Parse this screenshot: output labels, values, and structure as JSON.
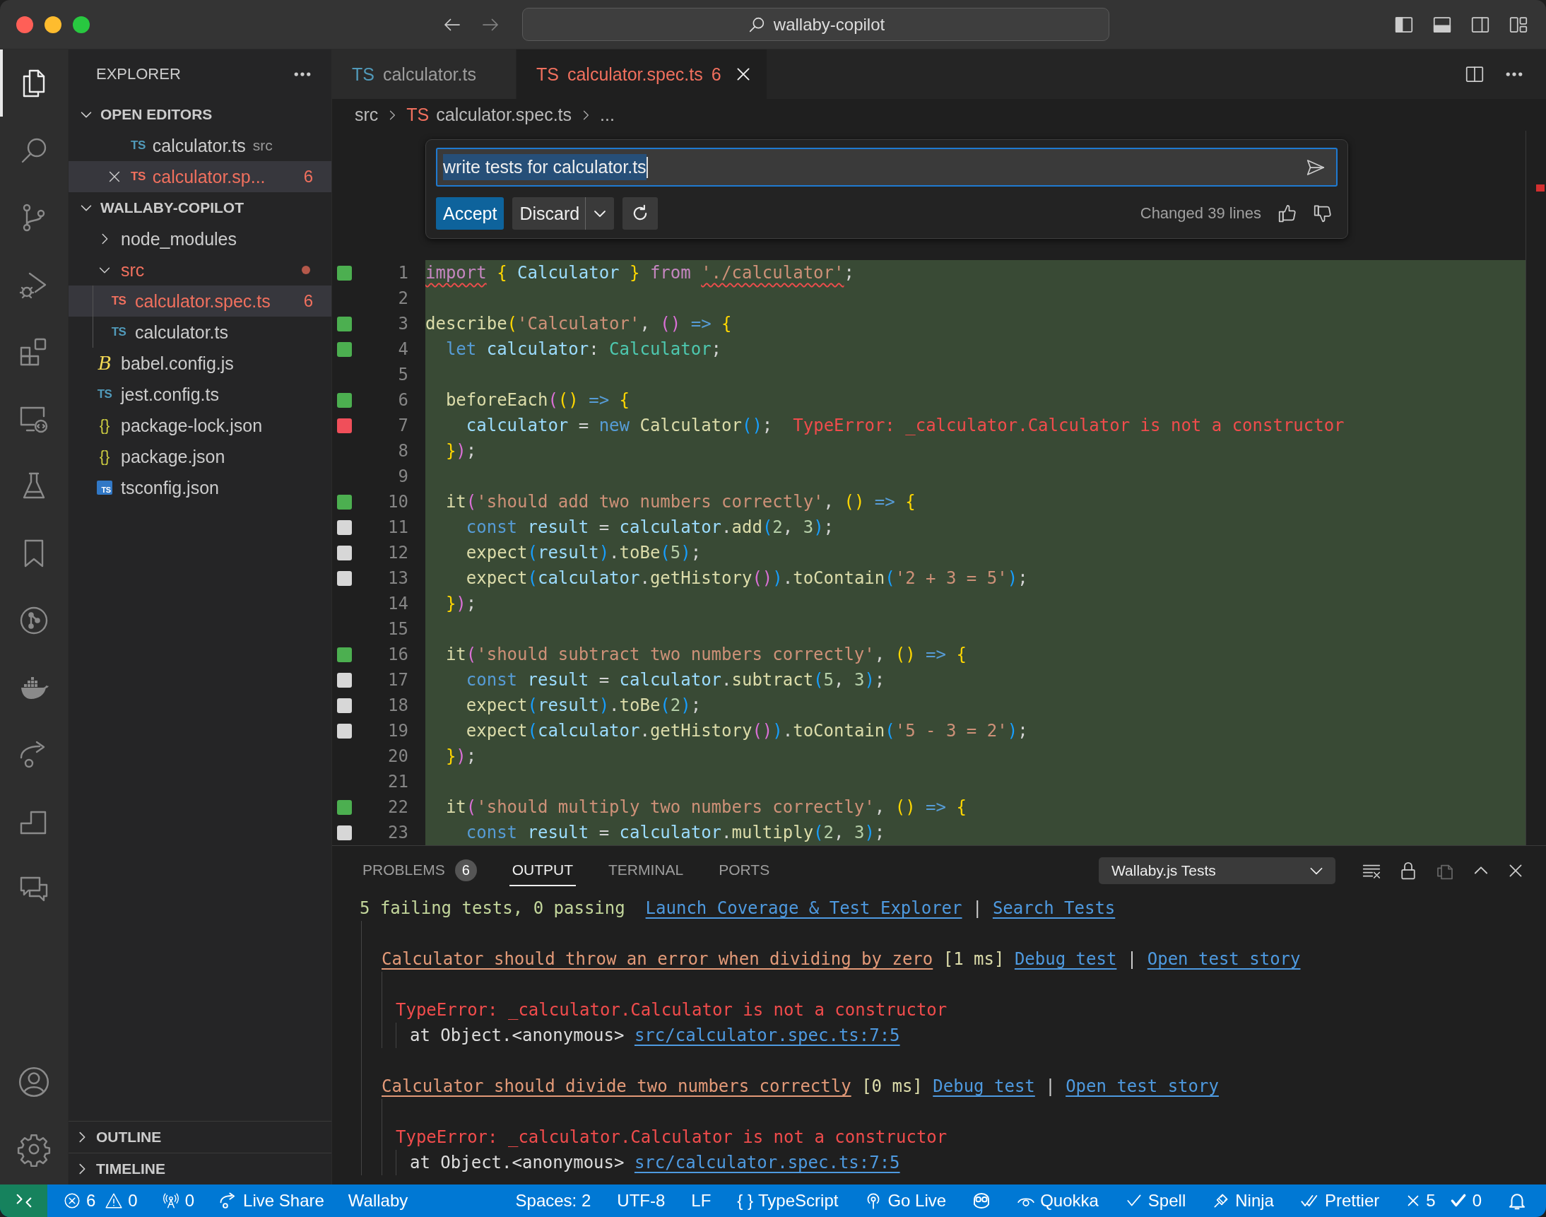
{
  "window": {
    "title": "wallaby-copilot"
  },
  "activity_bar": [
    {
      "kind": "explorer",
      "selected": true
    },
    {
      "kind": "search",
      "selected": false
    },
    {
      "kind": "source_control",
      "selected": false
    },
    {
      "kind": "run_debug",
      "selected": false
    },
    {
      "kind": "extensions",
      "selected": false
    },
    {
      "kind": "remote",
      "selected": false
    },
    {
      "kind": "testing",
      "selected": false
    },
    {
      "kind": "bookmarks",
      "selected": false
    },
    {
      "kind": "git_graph",
      "selected": false
    },
    {
      "kind": "docker",
      "selected": false
    },
    {
      "kind": "live_share",
      "selected": false
    },
    {
      "kind": "steps",
      "selected": false
    },
    {
      "kind": "comments",
      "selected": false
    }
  ],
  "activity_bar_bottom": [
    {
      "kind": "accounts"
    },
    {
      "kind": "settings"
    }
  ],
  "sidebar": {
    "title": "EXPLORER",
    "open_editors": {
      "title": "OPEN EDITORS",
      "expanded": true,
      "items": [
        {
          "kind": "ts",
          "icon": "TS",
          "name": "calculator.ts",
          "description": "src",
          "selected": false,
          "has_errors": false,
          "closable": false
        },
        {
          "kind": "ts",
          "icon": "TS",
          "name": "calculator.sp...",
          "count": "6",
          "selected": true,
          "has_errors": true,
          "closable": true
        }
      ]
    },
    "folder": {
      "title": "WALLABY-COPILOT",
      "expanded": true,
      "items": [
        {
          "kind": "folder",
          "name": "node_modules",
          "expanded": false,
          "selected": false,
          "has_errors": false
        },
        {
          "kind": "folder",
          "name": "src",
          "expanded": true,
          "selected": false,
          "has_errors": true,
          "children": [
            {
              "kind": "ts",
              "icon": "TS",
              "name": "calculator.spec.ts",
              "count": "6",
              "selected": true,
              "has_errors": true
            },
            {
              "kind": "ts",
              "icon": "TS",
              "name": "calculator.ts",
              "selected": false,
              "has_errors": false
            }
          ]
        },
        {
          "kind": "babel",
          "icon": "B",
          "name": "babel.config.js",
          "selected": false,
          "has_errors": false
        },
        {
          "kind": "ts",
          "icon": "TS",
          "name": "jest.config.ts",
          "selected": false,
          "has_errors": false
        },
        {
          "kind": "json",
          "icon": "{}",
          "name": "package-lock.json",
          "selected": false,
          "has_errors": false
        },
        {
          "kind": "json",
          "icon": "{}",
          "name": "package.json",
          "selected": false,
          "has_errors": false
        },
        {
          "kind": "tsconfig",
          "icon": "TS",
          "name": "tsconfig.json",
          "selected": false,
          "has_errors": false
        }
      ]
    },
    "sections": [
      {
        "title": "OUTLINE",
        "expanded": false
      },
      {
        "title": "TIMELINE",
        "expanded": false
      }
    ]
  },
  "editor": {
    "tabs": [
      {
        "icon": "TS",
        "label": "calculator.ts",
        "selected": false,
        "has_errors": false
      },
      {
        "icon": "TS",
        "label": "calculator.spec.ts",
        "count": "6",
        "selected": true,
        "has_errors": true
      }
    ],
    "breadcrumbs": [
      {
        "label": "src"
      },
      {
        "icon": "TS",
        "label": "calculator.spec.ts"
      },
      {
        "label": "..."
      }
    ],
    "inline_chat": {
      "value": "write tests for calculator.ts",
      "buttons": [
        {
          "kind": "primary",
          "label": "Accept"
        },
        {
          "kind": "split",
          "label": "Discard"
        },
        {
          "kind": "regenerate"
        }
      ],
      "status": "Changed 39 lines"
    },
    "code": {
      "inserted": true,
      "lines": [
        {
          "number": "1",
          "color": "#4caf50",
          "tokens": [
            {
              "kind": "keyword",
              "text": "import",
              "squiggle": true
            },
            {
              "kind": "bracket1",
              "text": " {",
              "squiggle": false
            },
            {
              "kind": "variable",
              "text": " Calculator ",
              "squiggle": false
            },
            {
              "kind": "bracket1",
              "text": "} ",
              "squiggle": false
            },
            {
              "kind": "keyword",
              "text": "from ",
              "squiggle": false
            },
            {
              "kind": "string",
              "text": "'./calculator'",
              "squiggle": true
            },
            {
              "kind": "punct",
              "text": ";",
              "squiggle": false
            }
          ]
        },
        {
          "number": "2"
        },
        {
          "number": "3",
          "color": "#4caf50",
          "tokens": [
            {
              "kind": "function",
              "text": "describe"
            },
            {
              "kind": "bracket1",
              "text": "("
            },
            {
              "kind": "string",
              "text": "'Calculator'"
            },
            {
              "kind": "punct",
              "text": ", "
            },
            {
              "kind": "bracket2",
              "text": "() "
            },
            {
              "kind": "storage",
              "text": "=> "
            },
            {
              "kind": "bracket1",
              "text": "{"
            }
          ]
        },
        {
          "number": "4",
          "color": "#4caf50",
          "tokens": [
            {
              "kind": "storage",
              "text": "  let"
            },
            {
              "kind": "variable",
              "text": " calculator"
            },
            {
              "kind": "punct",
              "text": ": "
            },
            {
              "kind": "type",
              "text": "Calculator"
            },
            {
              "kind": "punct",
              "text": ";"
            }
          ]
        },
        {
          "number": "5"
        },
        {
          "number": "6",
          "color": "#4caf50",
          "tokens": [
            {
              "kind": "function",
              "text": "  beforeEach"
            },
            {
              "kind": "bracket2",
              "text": "("
            },
            {
              "kind": "bracket1",
              "text": "() "
            },
            {
              "kind": "storage",
              "text": "=> "
            },
            {
              "kind": "bracket1",
              "text": "{"
            }
          ]
        },
        {
          "number": "7",
          "color": "#f04f5a",
          "tokens": [
            {
              "kind": "variable",
              "text": "    calculator"
            },
            {
              "kind": "punct",
              "text": " = "
            },
            {
              "kind": "storage",
              "text": "new "
            },
            {
              "kind": "function",
              "text": "Calculator"
            },
            {
              "kind": "bracket3",
              "text": "()"
            },
            {
              "kind": "punct",
              "text": ";"
            }
          ],
          "error": "TypeError: _calculator.Calculator is not a constructor"
        },
        {
          "number": "8",
          "tokens": [
            {
              "kind": "bracket1",
              "text": "  }"
            },
            {
              "kind": "bracket2",
              "text": ")"
            },
            {
              "kind": "punct",
              "text": ";"
            }
          ]
        },
        {
          "number": "9"
        },
        {
          "number": "10",
          "color": "#4caf50",
          "tokens": [
            {
              "kind": "function",
              "text": "  it"
            },
            {
              "kind": "bracket2",
              "text": "("
            },
            {
              "kind": "string",
              "text": "'should add two numbers correctly'"
            },
            {
              "kind": "punct",
              "text": ", "
            },
            {
              "kind": "bracket1",
              "text": "() "
            },
            {
              "kind": "storage",
              "text": "=> "
            },
            {
              "kind": "bracket1",
              "text": "{"
            }
          ]
        },
        {
          "number": "11",
          "color": "#d7d7d7",
          "tokens": [
            {
              "kind": "storage",
              "text": "    const"
            },
            {
              "kind": "variable",
              "text": " result"
            },
            {
              "kind": "punct",
              "text": " = "
            },
            {
              "kind": "variable",
              "text": "calculator"
            },
            {
              "kind": "punct",
              "text": "."
            },
            {
              "kind": "function",
              "text": "add"
            },
            {
              "kind": "bracket3",
              "text": "("
            },
            {
              "kind": "number",
              "text": "2"
            },
            {
              "kind": "punct",
              "text": ", "
            },
            {
              "kind": "number",
              "text": "3"
            },
            {
              "kind": "bracket3",
              "text": ")"
            },
            {
              "kind": "punct",
              "text": ";"
            }
          ]
        },
        {
          "number": "12",
          "color": "#d7d7d7",
          "tokens": [
            {
              "kind": "function",
              "text": "    expect"
            },
            {
              "kind": "bracket3",
              "text": "("
            },
            {
              "kind": "variable",
              "text": "result"
            },
            {
              "kind": "bracket3",
              "text": ")"
            },
            {
              "kind": "punct",
              "text": "."
            },
            {
              "kind": "function",
              "text": "toBe"
            },
            {
              "kind": "bracket3",
              "text": "("
            },
            {
              "kind": "number",
              "text": "5"
            },
            {
              "kind": "bracket3",
              "text": ")"
            },
            {
              "kind": "punct",
              "text": ";"
            }
          ]
        },
        {
          "number": "13",
          "color": "#d7d7d7",
          "tokens": [
            {
              "kind": "function",
              "text": "    expect"
            },
            {
              "kind": "bracket3",
              "text": "("
            },
            {
              "kind": "variable",
              "text": "calculator"
            },
            {
              "kind": "punct",
              "text": "."
            },
            {
              "kind": "function",
              "text": "getHistory"
            },
            {
              "kind": "bracket2",
              "text": "()"
            },
            {
              "kind": "bracket3",
              "text": ")"
            },
            {
              "kind": "punct",
              "text": "."
            },
            {
              "kind": "function",
              "text": "toContain"
            },
            {
              "kind": "bracket3",
              "text": "("
            },
            {
              "kind": "string",
              "text": "'2 + 3 = 5'"
            },
            {
              "kind": "bracket3",
              "text": ")"
            },
            {
              "kind": "punct",
              "text": ";"
            }
          ]
        },
        {
          "number": "14",
          "tokens": [
            {
              "kind": "bracket1",
              "text": "  }"
            },
            {
              "kind": "bracket2",
              "text": ")"
            },
            {
              "kind": "punct",
              "text": ";"
            }
          ]
        },
        {
          "number": "15"
        },
        {
          "number": "16",
          "color": "#4caf50",
          "tokens": [
            {
              "kind": "function",
              "text": "  it"
            },
            {
              "kind": "bracket2",
              "text": "("
            },
            {
              "kind": "string",
              "text": "'should subtract two numbers correctly'"
            },
            {
              "kind": "punct",
              "text": ", "
            },
            {
              "kind": "bracket1",
              "text": "() "
            },
            {
              "kind": "storage",
              "text": "=> "
            },
            {
              "kind": "bracket1",
              "text": "{"
            }
          ]
        },
        {
          "number": "17",
          "color": "#d7d7d7",
          "tokens": [
            {
              "kind": "storage",
              "text": "    const"
            },
            {
              "kind": "variable",
              "text": " result"
            },
            {
              "kind": "punct",
              "text": " = "
            },
            {
              "kind": "variable",
              "text": "calculator"
            },
            {
              "kind": "punct",
              "text": "."
            },
            {
              "kind": "function",
              "text": "subtract"
            },
            {
              "kind": "bracket3",
              "text": "("
            },
            {
              "kind": "number",
              "text": "5"
            },
            {
              "kind": "punct",
              "text": ", "
            },
            {
              "kind": "number",
              "text": "3"
            },
            {
              "kind": "bracket3",
              "text": ")"
            },
            {
              "kind": "punct",
              "text": ";"
            }
          ]
        },
        {
          "number": "18",
          "color": "#d7d7d7",
          "tokens": [
            {
              "kind": "function",
              "text": "    expect"
            },
            {
              "kind": "bracket3",
              "text": "("
            },
            {
              "kind": "variable",
              "text": "result"
            },
            {
              "kind": "bracket3",
              "text": ")"
            },
            {
              "kind": "punct",
              "text": "."
            },
            {
              "kind": "function",
              "text": "toBe"
            },
            {
              "kind": "bracket3",
              "text": "("
            },
            {
              "kind": "number",
              "text": "2"
            },
            {
              "kind": "bracket3",
              "text": ")"
            },
            {
              "kind": "punct",
              "text": ";"
            }
          ]
        },
        {
          "number": "19",
          "color": "#d7d7d7",
          "tokens": [
            {
              "kind": "function",
              "text": "    expect"
            },
            {
              "kind": "bracket3",
              "text": "("
            },
            {
              "kind": "variable",
              "text": "calculator"
            },
            {
              "kind": "punct",
              "text": "."
            },
            {
              "kind": "function",
              "text": "getHistory"
            },
            {
              "kind": "bracket2",
              "text": "()"
            },
            {
              "kind": "bracket3",
              "text": ")"
            },
            {
              "kind": "punct",
              "text": "."
            },
            {
              "kind": "function",
              "text": "toContain"
            },
            {
              "kind": "bracket3",
              "text": "("
            },
            {
              "kind": "string",
              "text": "'5 - 3 = 2'"
            },
            {
              "kind": "bracket3",
              "text": ")"
            },
            {
              "kind": "punct",
              "text": ";"
            }
          ]
        },
        {
          "number": "20",
          "tokens": [
            {
              "kind": "bracket1",
              "text": "  }"
            },
            {
              "kind": "bracket2",
              "text": ")"
            },
            {
              "kind": "punct",
              "text": ";"
            }
          ]
        },
        {
          "number": "21"
        },
        {
          "number": "22",
          "color": "#4caf50",
          "tokens": [
            {
              "kind": "function",
              "text": "  it"
            },
            {
              "kind": "bracket2",
              "text": "("
            },
            {
              "kind": "string",
              "text": "'should multiply two numbers correctly'"
            },
            {
              "kind": "punct",
              "text": ", "
            },
            {
              "kind": "bracket1",
              "text": "() "
            },
            {
              "kind": "storage",
              "text": "=> "
            },
            {
              "kind": "bracket1",
              "text": "{"
            }
          ]
        },
        {
          "number": "23",
          "color": "#d7d7d7",
          "tokens": [
            {
              "kind": "storage",
              "text": "    const"
            },
            {
              "kind": "variable",
              "text": " result"
            },
            {
              "kind": "punct",
              "text": " = "
            },
            {
              "kind": "variable",
              "text": "calculator"
            },
            {
              "kind": "punct",
              "text": "."
            },
            {
              "kind": "function",
              "text": "multiply"
            },
            {
              "kind": "bracket3",
              "text": "("
            },
            {
              "kind": "number",
              "text": "2"
            },
            {
              "kind": "punct",
              "text": ", "
            },
            {
              "kind": "number",
              "text": "3"
            },
            {
              "kind": "bracket3",
              "text": ")"
            },
            {
              "kind": "punct",
              "text": ";"
            }
          ]
        }
      ]
    }
  },
  "panel": {
    "tabs": [
      {
        "label": "PROBLEMS",
        "count": "6",
        "selected": false
      },
      {
        "label": "OUTPUT",
        "selected": true
      },
      {
        "label": "TERMINAL",
        "selected": false
      },
      {
        "label": "PORTS",
        "selected": false
      }
    ],
    "channel": "Wallaby.js Tests",
    "output": {
      "summary": {
        "text": "5 failing tests, 0 passing",
        "links": [
          "Launch Coverage & Test Explorer",
          "Search Tests"
        ],
        "separator": "|"
      },
      "tests": [
        {
          "name": "Calculator should throw an error when dividing by zero",
          "duration": "[1 ms]",
          "links": [
            "Debug test",
            "Open test story"
          ],
          "separator": "|",
          "error": "TypeError: _calculator.Calculator is not a constructor",
          "stack": "at Object.<anonymous>",
          "location": "src/calculator.spec.ts:7:5"
        },
        {
          "name": "Calculator should divide two numbers correctly",
          "duration": "[0 ms]",
          "links": [
            "Debug test",
            "Open test story"
          ],
          "separator": "|",
          "error": "TypeError: _calculator.Calculator is not a constructor",
          "stack": "at Object.<anonymous>",
          "location": "src/calculator.spec.ts:7:5"
        }
      ]
    }
  },
  "status_bar": {
    "left": [
      {
        "kind": "remote"
      },
      {
        "kind": "problems",
        "errors": "6",
        "warnings": "0"
      },
      {
        "kind": "ports",
        "text": "0"
      },
      {
        "kind": "live_share",
        "text": "Live Share"
      },
      {
        "kind": "plain",
        "text": "Wallaby"
      }
    ],
    "right": [
      {
        "kind": "plain",
        "text": "Spaces: 2"
      },
      {
        "kind": "plain",
        "text": "UTF-8"
      },
      {
        "kind": "plain",
        "text": "LF"
      },
      {
        "kind": "language",
        "icon": "{ }",
        "text": "TypeScript"
      },
      {
        "kind": "go_live",
        "text": "Go Live"
      },
      {
        "kind": "copilot"
      },
      {
        "kind": "quokka",
        "text": "Quokka"
      },
      {
        "kind": "spell",
        "text": "Spell"
      },
      {
        "kind": "ninja",
        "text": "Ninja"
      },
      {
        "kind": "prettier",
        "text": "Prettier"
      },
      {
        "kind": "tests",
        "failed": "5",
        "passed": "0"
      },
      {
        "kind": "notifications"
      }
    ]
  }
}
